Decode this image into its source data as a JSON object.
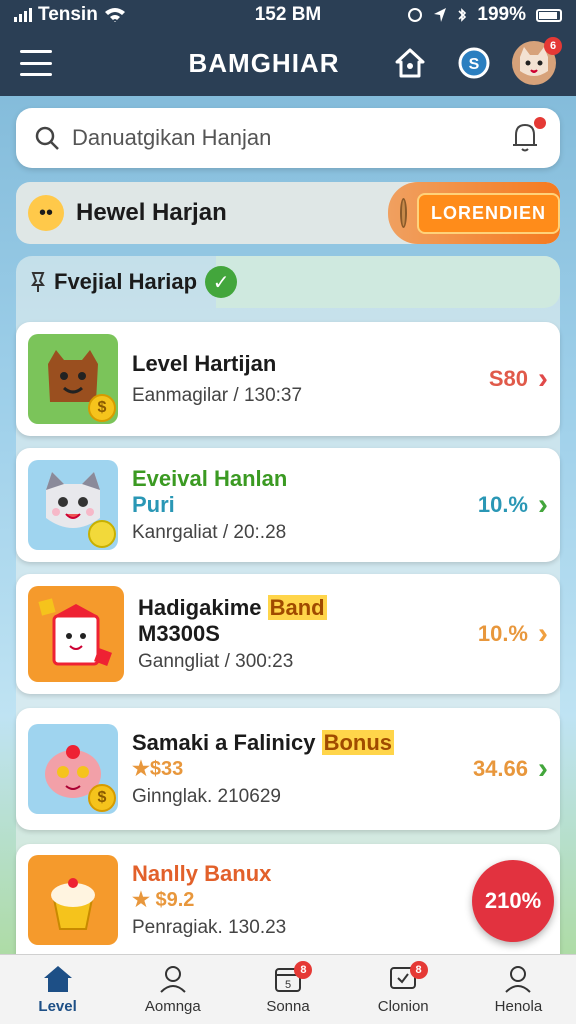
{
  "status_bar": {
    "carrier": "Tensin",
    "time": "152 BM",
    "battery": "199%"
  },
  "header": {
    "title": "BAMGHIAR",
    "notifications_badge": "6"
  },
  "search": {
    "placeholder": "Danuatgikan Hanjan"
  },
  "banner": {
    "title": "Hewel Harjan",
    "button_label": "LORENDIEN"
  },
  "section": {
    "title": "Fvejial Hariap"
  },
  "cards": [
    {
      "title": "Level Hartijan",
      "title2": "",
      "subtitle": "Eanmagilar / 130:37",
      "value": "S80",
      "value_color": "#e05a4a",
      "chevron_color": "#e04a4a",
      "thumb_bg": "#7bc45a",
      "icon": "bear-icon"
    },
    {
      "title": "Eveival Hanlan",
      "title2": "Puri",
      "subtitle": "Kanrgaliat / 20:.28",
      "value": "10.%",
      "value_color": "#2a97b5",
      "chevron_color": "#43a63c",
      "thumb_bg": "#9fd4ef",
      "icon": "cat-icon"
    },
    {
      "title": "Hadigakime",
      "title_highlight": "Band",
      "title2": "M3300S",
      "subtitle": "Ganngliat / 300:23",
      "value": "10.%",
      "value_color": "#e8973c",
      "chevron_color": "#f0a040",
      "thumb_bg": "#f59a2c",
      "icon": "gift-box-icon"
    },
    {
      "title": "Samaki a Falinicy",
      "title_highlight": "Bonus",
      "title2": "★$33",
      "subtitle": "Ginnglak. 210629",
      "value": "34.66",
      "value_color": "#e8973c",
      "chevron_color": "#43a63c",
      "thumb_bg": "#9fd4ef",
      "icon": "cake-icon"
    },
    {
      "title": "Nanlly Banux",
      "title2": "★ $9.2",
      "subtitle": "Penragiak. 130.23",
      "value": "",
      "value_color": "#e8973c",
      "chevron_color": "#43a63c",
      "thumb_bg": "#f59a2c",
      "icon": "cupcake-icon"
    }
  ],
  "fab": {
    "label": "210%"
  },
  "bottom_nav": [
    {
      "label": "Level",
      "icon": "home-icon",
      "badge": ""
    },
    {
      "label": "Aomnga",
      "icon": "user-icon",
      "badge": ""
    },
    {
      "label": "Sonna",
      "icon": "calendar-icon",
      "badge": "8"
    },
    {
      "label": "Clonion",
      "icon": "chat-icon",
      "badge": "8"
    },
    {
      "label": "Henola",
      "icon": "profile-icon",
      "badge": ""
    }
  ]
}
